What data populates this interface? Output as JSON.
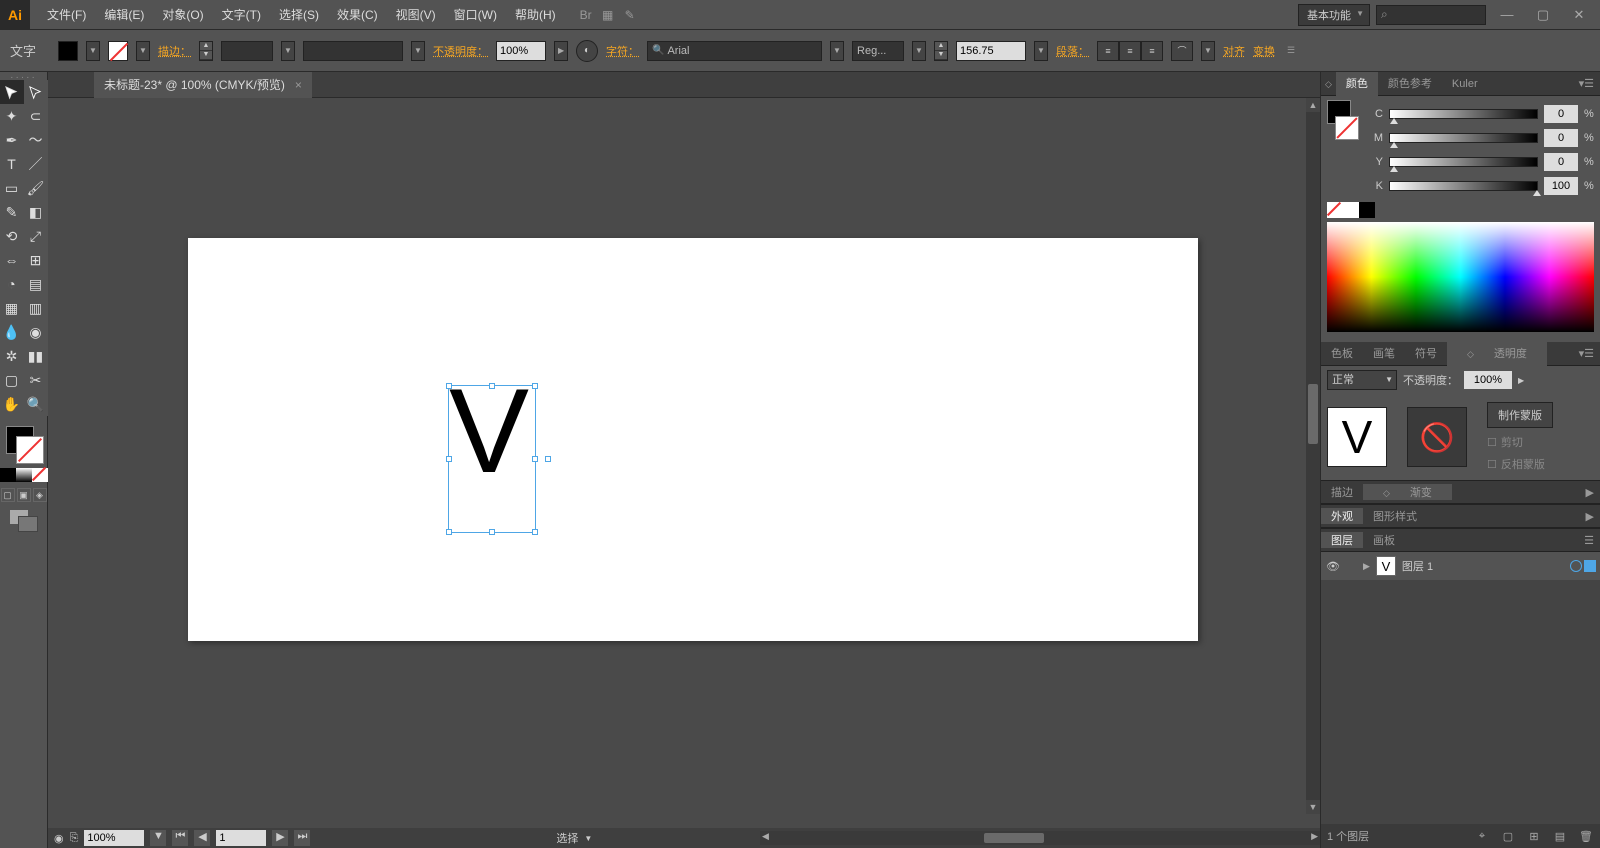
{
  "menu": {
    "items": [
      "文件(F)",
      "编辑(E)",
      "对象(O)",
      "文字(T)",
      "选择(S)",
      "效果(C)",
      "视图(V)",
      "窗口(W)",
      "帮助(H)"
    ]
  },
  "workspace_label": "基本功能",
  "optbar": {
    "mode": "文字",
    "stroke": "描边：",
    "opacity": "不透明度：",
    "opacity_val": "100%",
    "char": "字符：",
    "font": "Arial",
    "style": "Reg...",
    "size": "156.75",
    "para": "段落：",
    "align": "对齐",
    "transform": "变换"
  },
  "doc_tab": "未标题-23* @ 100% (CMYK/预览)",
  "canvas_char": "V",
  "status": {
    "zoom": "100%",
    "page": "1",
    "sel": "选择"
  },
  "color_panel": {
    "tabs": [
      "颜色",
      "颜色参考",
      "Kuler"
    ],
    "channels": [
      {
        "l": "C",
        "v": "0"
      },
      {
        "l": "M",
        "v": "0"
      },
      {
        "l": "Y",
        "v": "0"
      },
      {
        "l": "K",
        "v": "100"
      }
    ]
  },
  "mid_tabs": [
    "色板",
    "画笔",
    "符号",
    "透明度"
  ],
  "trans": {
    "mode": "正常",
    "op_label": "不透明度：",
    "op_val": "100%",
    "mask": "制作蒙版",
    "clip": "剪切",
    "invert": "反相蒙版"
  },
  "row2": [
    "描边",
    "渐变"
  ],
  "row3": [
    "外观",
    "图形样式"
  ],
  "row4": [
    "图层",
    "画板"
  ],
  "layer": {
    "name": "图层 1",
    "count": "1 个图层"
  }
}
